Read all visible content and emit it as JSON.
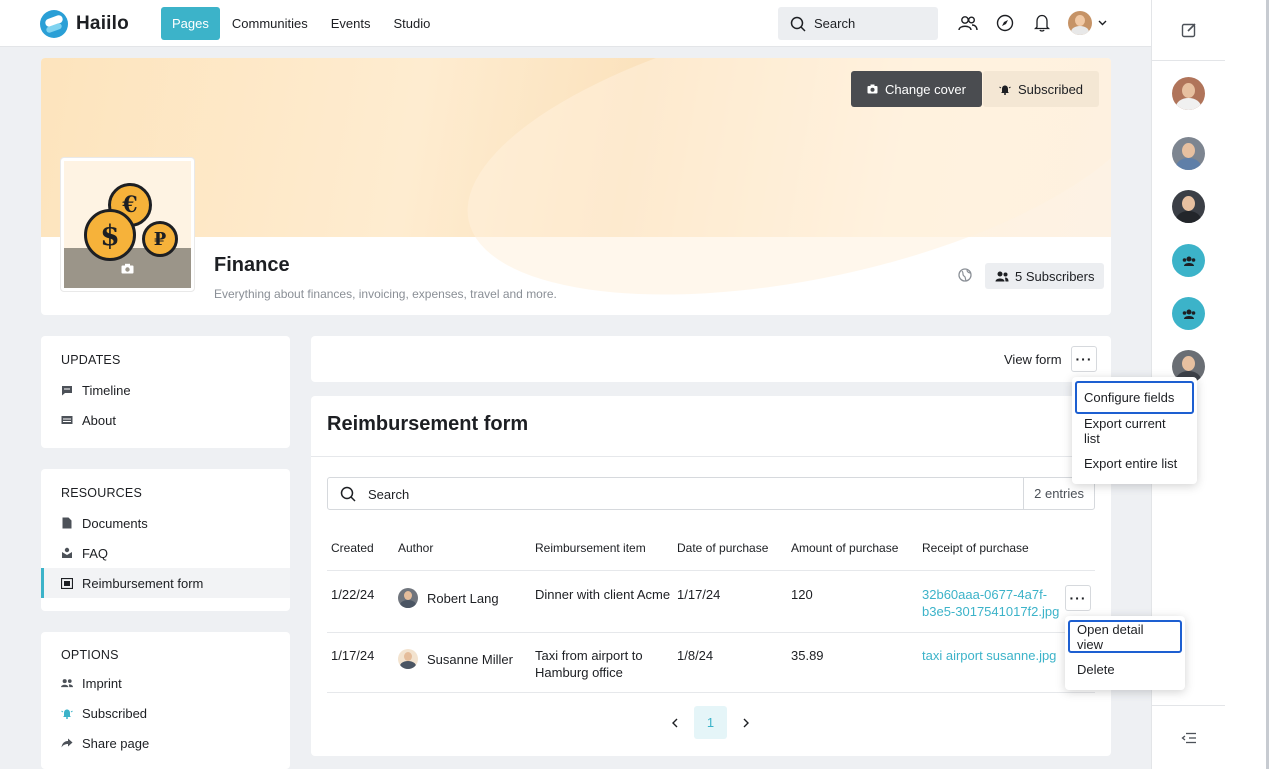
{
  "app": {
    "logo_text": "Haiilo"
  },
  "nav": {
    "items": [
      {
        "label": "Pages",
        "active": true
      },
      {
        "label": "Communities"
      },
      {
        "label": "Events"
      },
      {
        "label": "Studio"
      }
    ],
    "search_label": "Search"
  },
  "cover": {
    "change_cover_label": "Change cover",
    "subscribed_label": "Subscribed"
  },
  "page": {
    "title": "Finance",
    "subtitle": "Everything about finances, invoicing, expenses, travel and more.",
    "subscribers_label": "5 Subscribers"
  },
  "sidebar": {
    "updates": {
      "heading": "UPDATES",
      "items": [
        "Timeline",
        "About"
      ]
    },
    "resources": {
      "heading": "RESOURCES",
      "items": [
        "Documents",
        "FAQ",
        "Reimbursement form"
      ],
      "active_index": 2
    },
    "options": {
      "heading": "OPTIONS",
      "items": [
        "Imprint",
        "Subscribed",
        "Share page"
      ]
    }
  },
  "viewbar": {
    "label": "View form"
  },
  "form_menu": {
    "items": [
      "Configure fields",
      "Export current list",
      "Export entire list"
    ]
  },
  "form": {
    "title": "Reimbursement form",
    "search_placeholder": "Search",
    "entries": "2 entries",
    "columns": [
      "Created",
      "Author",
      "Reimbursement item",
      "Date of purchase",
      "Amount of purchase",
      "Receipt of purchase"
    ],
    "rows": [
      {
        "created": "1/22/24",
        "author": "Robert Lang",
        "item": "Dinner with client Acme",
        "date": "1/17/24",
        "amount": "120",
        "receipt_line1": "32b60aaa-0677-4a7f-",
        "receipt_line2": "b3e5-3017541017f2.jpg"
      },
      {
        "created": "1/17/24",
        "author": "Susanne Miller",
        "item_line1": "Taxi from airport to",
        "item_line2": "Hamburg office",
        "date": "1/8/24",
        "amount": "35.89",
        "receipt": "taxi airport susanne.jpg"
      }
    ],
    "current_page": "1"
  },
  "row_menu": {
    "items": [
      "Open detail view",
      "Delete"
    ]
  },
  "colors": {
    "accent": "#3cb3c9",
    "focus": "#1d5fd1",
    "dark_button": "#4a4c50"
  }
}
